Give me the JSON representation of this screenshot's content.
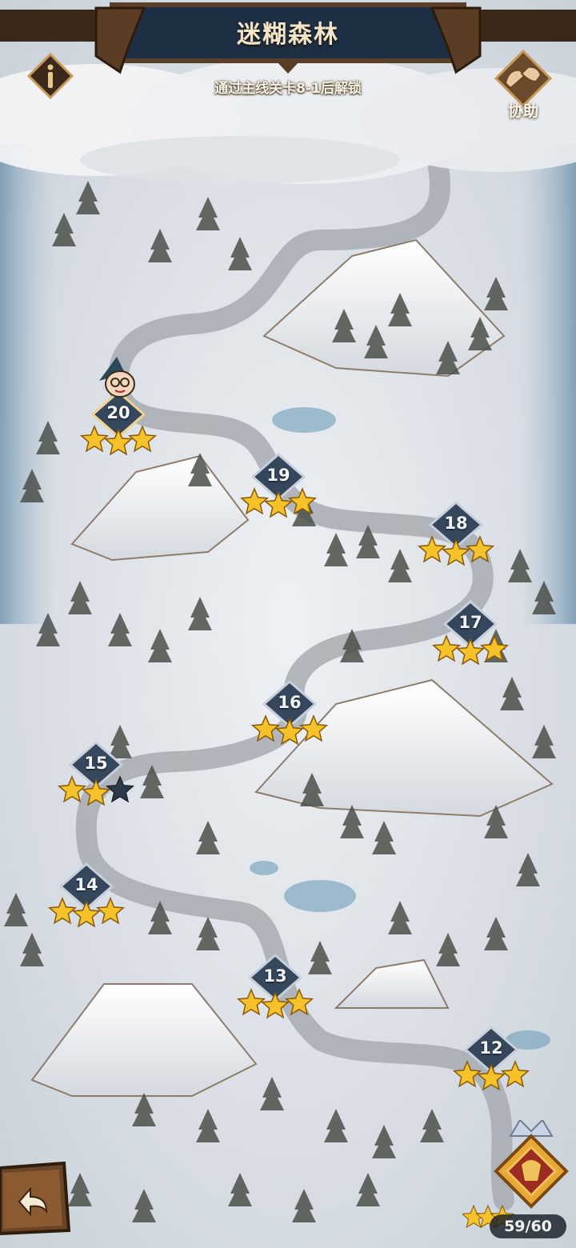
{
  "header": {
    "title": "迷糊森林",
    "unlock_hint": "通过主线关卡8-1后解锁"
  },
  "buttons": {
    "info_label": "i",
    "assist_label": "协助"
  },
  "stages": [
    {
      "number": "20",
      "stars": 3,
      "current": true
    },
    {
      "number": "19",
      "stars": 3
    },
    {
      "number": "18",
      "stars": 3
    },
    {
      "number": "17",
      "stars": 3
    },
    {
      "number": "16",
      "stars": 3
    },
    {
      "number": "15",
      "stars": 2
    },
    {
      "number": "14",
      "stars": 3
    },
    {
      "number": "13",
      "stars": 3
    },
    {
      "number": "12",
      "stars": 3
    }
  ],
  "star_progress": {
    "label": "59/60",
    "collected": 59,
    "total": 60
  },
  "icons": {
    "back": "back-arrow-icon",
    "assist": "fist-bump-icon",
    "chest": "reward-chest-icon",
    "info": "info-icon"
  },
  "colors": {
    "star_gold": "#f6c22a",
    "star_empty": "#2d3a4a",
    "node_fill": "#34475c",
    "banner_wood": "#4a3320",
    "banner_cloth": "#1e2f44",
    "snow": "#e6eaee",
    "path": "#a7abb1"
  }
}
